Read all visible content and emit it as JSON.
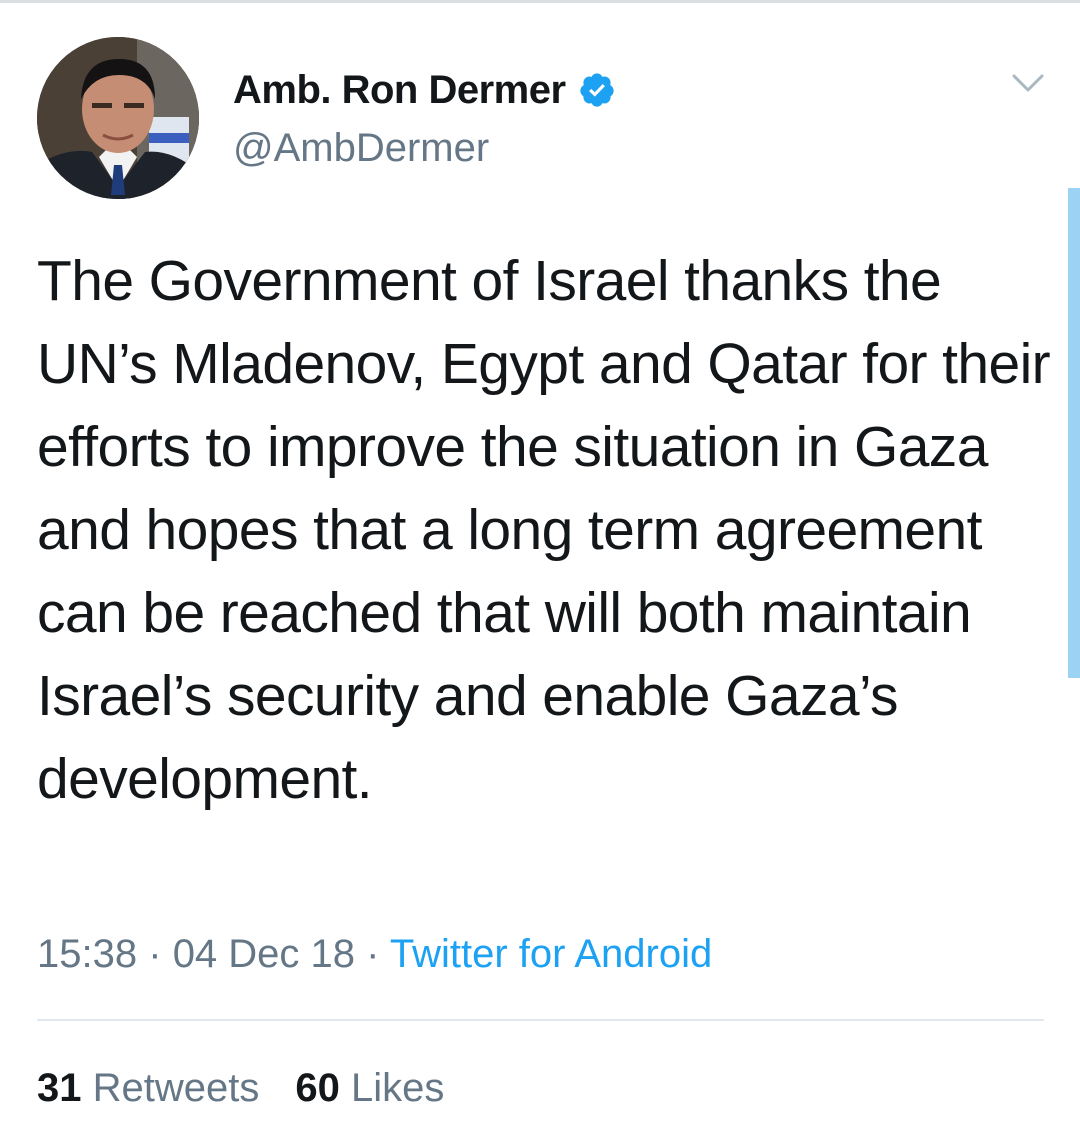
{
  "tweet": {
    "author": {
      "display_name": "Amb. Ron Dermer",
      "handle": "@AmbDermer",
      "verified": true,
      "avatar_icon": "profile-photo"
    },
    "menu_icon": "chevron-down-icon",
    "text": "The Government of Israel thanks the UN’s Mladenov, Egypt and Qatar for their efforts to improve the situation in Gaza and hopes that a long term agreement can be reached that will both maintain Israel’s security and enable Gaza’s development.",
    "time": "15:38",
    "separator": "·",
    "date": "04 Dec 18",
    "source": "Twitter for Android",
    "stats": {
      "retweets_count": "31",
      "retweets_label": "Retweets",
      "likes_count": "60",
      "likes_label": "Likes"
    }
  },
  "colors": {
    "text_primary": "#14171a",
    "text_secondary": "#657786",
    "accent": "#1da1f2",
    "divider": "#e1e8ed"
  }
}
